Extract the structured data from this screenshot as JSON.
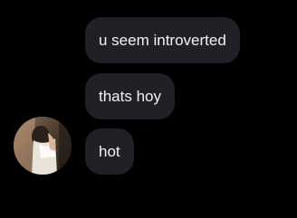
{
  "messages": [
    {
      "text": "u seem introverted"
    },
    {
      "text": "thats hoy"
    },
    {
      "text": "hot"
    }
  ],
  "colors": {
    "background": "#000000",
    "bubble": "#1f2126",
    "text": "#f2f2f2"
  },
  "icons": {
    "avatar": "profile-photo"
  }
}
